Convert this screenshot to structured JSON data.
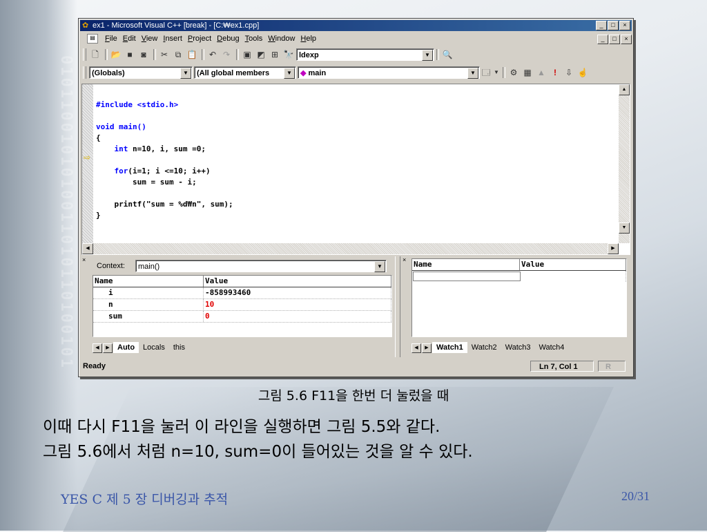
{
  "window": {
    "title": "ex1 - Microsoft Visual C++ [break] - [C:₩ex1.cpp]",
    "controls": [
      "_",
      "□",
      "×"
    ]
  },
  "menubar": {
    "items": [
      "File",
      "Edit",
      "View",
      "Insert",
      "Project",
      "Debug",
      "Tools",
      "Window",
      "Help"
    ]
  },
  "toolbar": {
    "find_value": "ldexp"
  },
  "wizardbar": {
    "scope": "(Globals)",
    "members": "(All global members",
    "function": "main"
  },
  "editor": {
    "lines": [
      "#include <stdio.h>",
      "",
      "void main()",
      "{",
      "    int n=10, i, sum =0;",
      "",
      "    for(i=1; i <=10; i++)",
      "        sum = sum - i;",
      "",
      "    printf(\"sum = %d₩n\", sum);",
      "}"
    ],
    "current_line_index": 6
  },
  "variables_pane": {
    "context_label": "Context:",
    "context_value": "main()",
    "columns": [
      "Name",
      "Value"
    ],
    "rows": [
      {
        "name": "i",
        "value": "-858993460",
        "changed": false
      },
      {
        "name": "n",
        "value": "10",
        "changed": true
      },
      {
        "name": "sum",
        "value": "0",
        "changed": true
      }
    ],
    "tabs": [
      "Auto",
      "Locals",
      "this"
    ],
    "active_tab": "Auto"
  },
  "watch_pane": {
    "columns": [
      "Name",
      "Value"
    ],
    "tabs": [
      "Watch1",
      "Watch2",
      "Watch3",
      "Watch4"
    ],
    "active_tab": "Watch1"
  },
  "statusbar": {
    "text": "Ready",
    "position": "Ln 7, Col 1",
    "mode": "R"
  },
  "slide": {
    "caption": "그림 5.6  F11을 한번 더 눌렀을 때",
    "body_line1": "이때 다시 F11을 눌러 이 라인을 실행하면 그림 5.5와 같다.",
    "body_line2": "그림 5.6에서 처럼 n=10, sum=0이 들어있는 것을 알 수 있다.",
    "footer_left": "YES C  제 5 장 디버깅과 추적",
    "footer_right": "20/31"
  },
  "colors": {
    "title_bar": "#0a246a",
    "keyword": "#0000ff",
    "changed_value": "#e00000",
    "footer_text": "#3a56a8"
  }
}
